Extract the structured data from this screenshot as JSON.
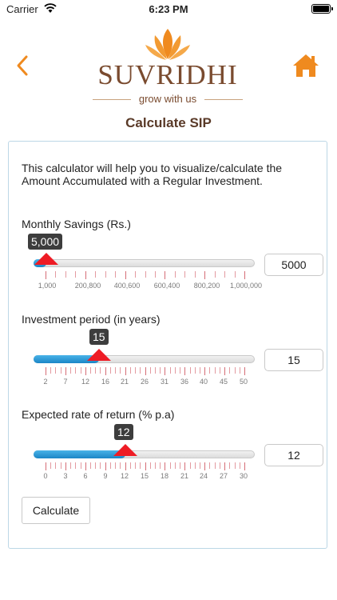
{
  "status": {
    "carrier": "Carrier",
    "time": "6:23 PM"
  },
  "logo": {
    "brand": "SUVRIDHI",
    "tagline": "grow with us"
  },
  "page_title": "Calculate SIP",
  "intro": "This calculator will help you to visualize/calculate the Amount Accumulated with a Regular Investment.",
  "sliders": [
    {
      "label": "Monthly Savings (Rs.)",
      "bubble": "5,000",
      "input_value": "5000",
      "min": 1000,
      "max": 1000000,
      "value": 5000,
      "tick_labels": [
        "1,000",
        "200,800",
        "400,600",
        "600,400",
        "800,200",
        "1,000,000"
      ]
    },
    {
      "label": "Investment period (in years)",
      "bubble": "15",
      "input_value": "15",
      "min": 2,
      "max": 50,
      "value": 15,
      "tick_labels": [
        "2",
        "7",
        "12",
        "16",
        "21",
        "26",
        "31",
        "36",
        "40",
        "45",
        "50"
      ]
    },
    {
      "label": "Expected rate of return (% p.a)",
      "bubble": "12",
      "input_value": "12",
      "min": 0,
      "max": 30,
      "value": 12,
      "tick_labels": [
        "0",
        "3",
        "6",
        "9",
        "12",
        "15",
        "18",
        "21",
        "24",
        "27",
        "30"
      ]
    }
  ],
  "calculate_button": "Calculate",
  "colors": {
    "accent": "#ef8a1f",
    "brand": "#7a4b2f",
    "thumb": "#ee1c25",
    "fill": "#1c86c6"
  }
}
